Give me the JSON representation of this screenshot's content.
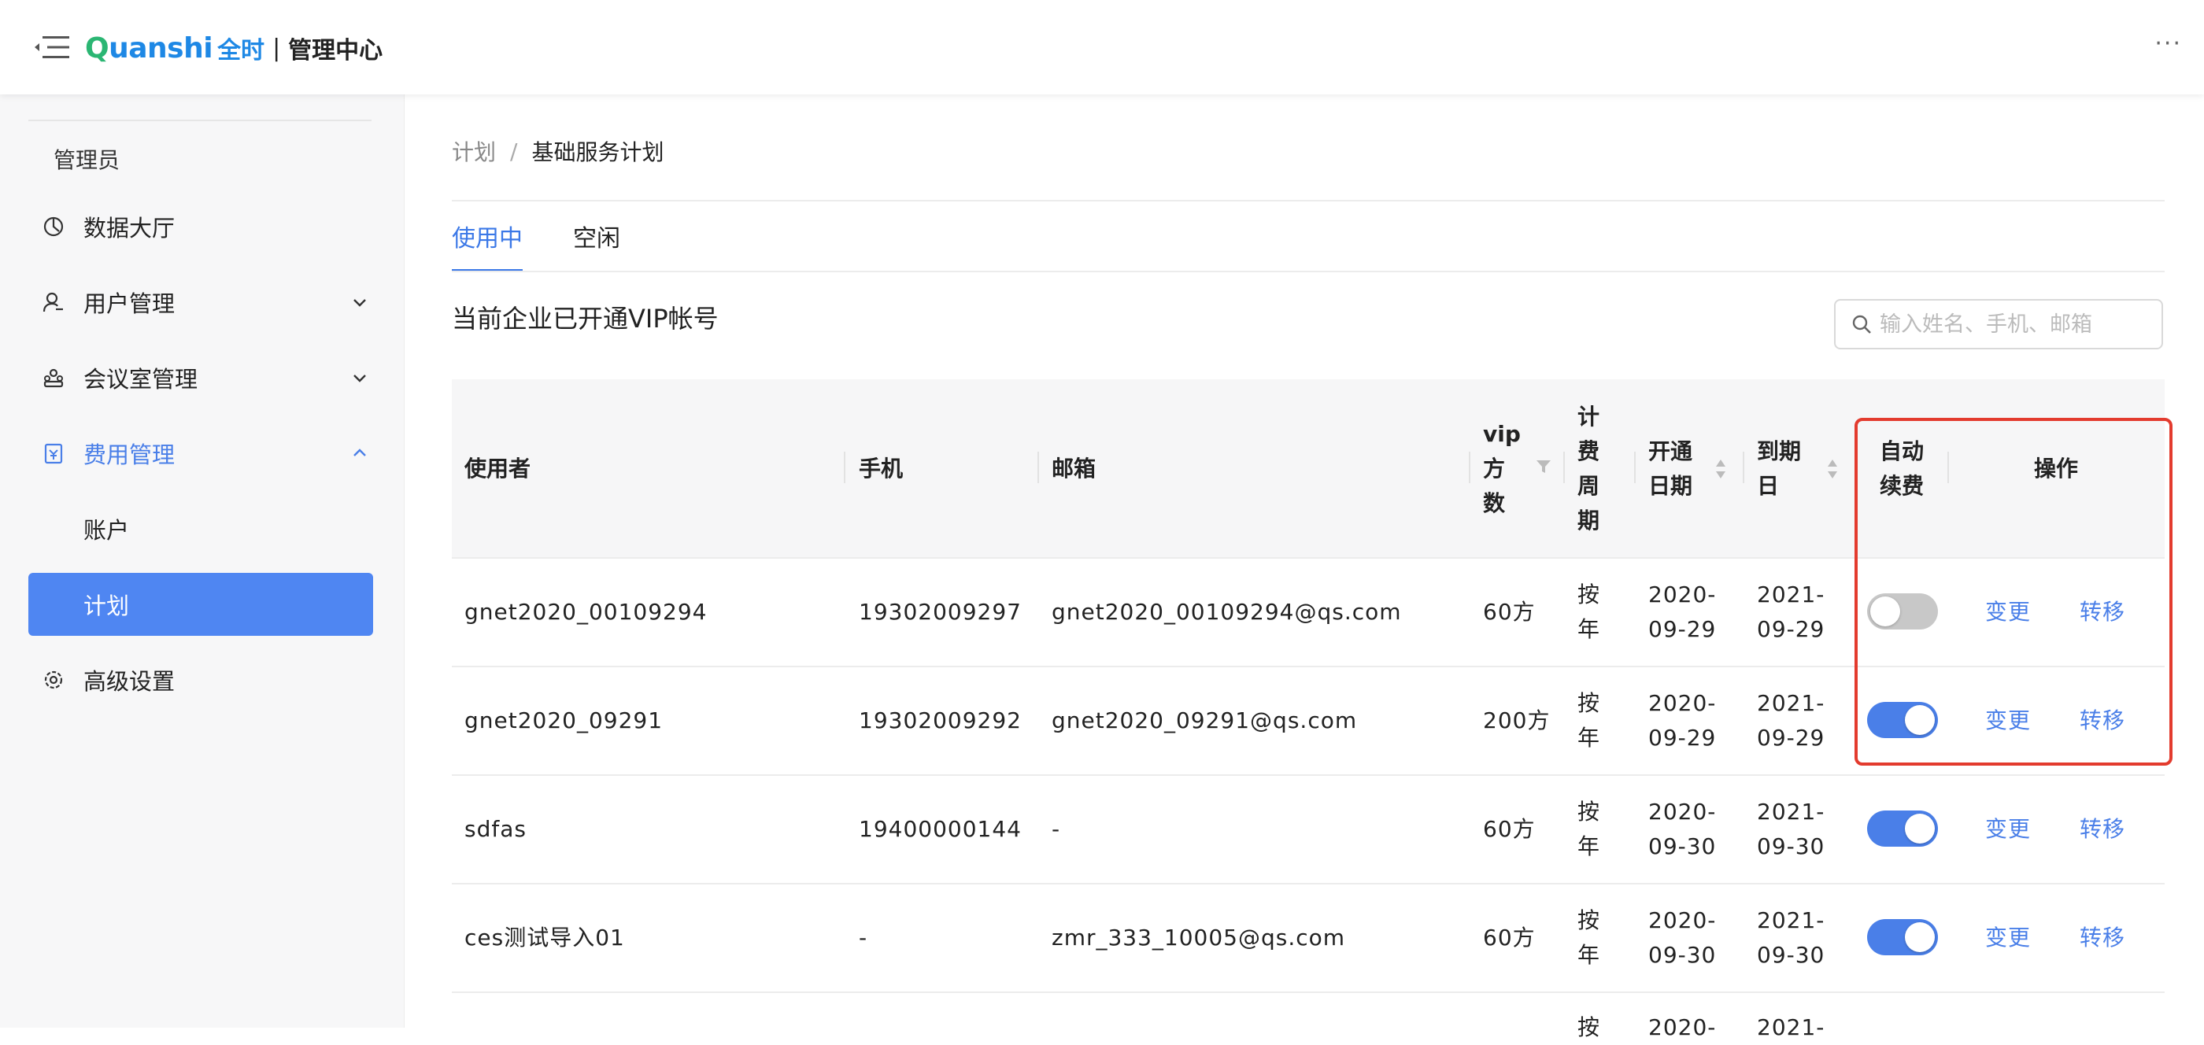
{
  "header": {
    "brand_part1": "Q",
    "brand_part2": "uanshi",
    "brand_cn": "全时",
    "separator": "|",
    "title": "管理中心",
    "more": "···"
  },
  "sidebar": {
    "role": "管理员",
    "items": [
      {
        "label": "数据大厅",
        "icon": "dashboard-icon"
      },
      {
        "label": "用户管理",
        "icon": "user-icon",
        "chevron": "down"
      },
      {
        "label": "会议室管理",
        "icon": "meeting-room-icon",
        "chevron": "down"
      },
      {
        "label": "费用管理",
        "icon": "billing-icon",
        "chevron": "up"
      },
      {
        "label": "账户"
      },
      {
        "label": "计划"
      },
      {
        "label": "高级设置",
        "icon": "settings-icon"
      }
    ]
  },
  "breadcrumb": {
    "parent": "计划",
    "separator": "/",
    "current": "基础服务计划"
  },
  "tabs": [
    {
      "label": "使用中"
    },
    {
      "label": "空闲"
    }
  ],
  "section_title": "当前企业已开通VIP帐号",
  "search": {
    "placeholder": "输入姓名、手机、邮箱"
  },
  "table": {
    "headers": {
      "user": "使用者",
      "phone": "手机",
      "email": "邮箱",
      "vip_1": "vip",
      "vip_2": "方",
      "vip_3": "数",
      "cycle_1": "计",
      "cycle_2": "费",
      "cycle_3": "周",
      "cycle_4": "期",
      "open_1": "开通",
      "open_2": "日期",
      "expire_1": "到期",
      "expire_2": "日",
      "auto_1": "自动",
      "auto_2": "续费",
      "ops": "操作"
    },
    "rows": [
      {
        "user": "gnet2020_00109294",
        "phone": "19302009297",
        "email": "gnet2020_00109294@qs.com",
        "vip": "60方",
        "cycle_1": "按",
        "cycle_2": "年",
        "open_1": "2020-",
        "open_2": "09-29",
        "expire_1": "2021-",
        "expire_2": "09-29",
        "auto_renew": false,
        "change": "变更",
        "transfer": "转移"
      },
      {
        "user": "gnet2020_09291",
        "phone": "19302009292",
        "email": "gnet2020_09291@qs.com",
        "vip": "200方",
        "cycle_1": "按",
        "cycle_2": "年",
        "open_1": "2020-",
        "open_2": "09-29",
        "expire_1": "2021-",
        "expire_2": "09-29",
        "auto_renew": true,
        "change": "变更",
        "transfer": "转移"
      },
      {
        "user": "sdfas",
        "phone": "19400000144",
        "email": "-",
        "vip": "60方",
        "cycle_1": "按",
        "cycle_2": "年",
        "open_1": "2020-",
        "open_2": "09-30",
        "expire_1": "2021-",
        "expire_2": "09-30",
        "auto_renew": true,
        "change": "变更",
        "transfer": "转移"
      },
      {
        "user": "ces测试导入01",
        "phone": "-",
        "email": "zmr_333_10005@qs.com",
        "vip": "60方",
        "cycle_1": "按",
        "cycle_2": "年",
        "open_1": "2020-",
        "open_2": "09-30",
        "expire_1": "2021-",
        "expire_2": "09-30",
        "auto_renew": true,
        "change": "变更",
        "transfer": "转移"
      },
      {
        "partial": true,
        "cycle_1": "按",
        "open_1": "2020-",
        "expire_1": "2021-"
      }
    ]
  },
  "colors": {
    "accent": "#4a7fe8",
    "highlight": "#e33b2e",
    "sidebar_active": "#4f86f2"
  }
}
